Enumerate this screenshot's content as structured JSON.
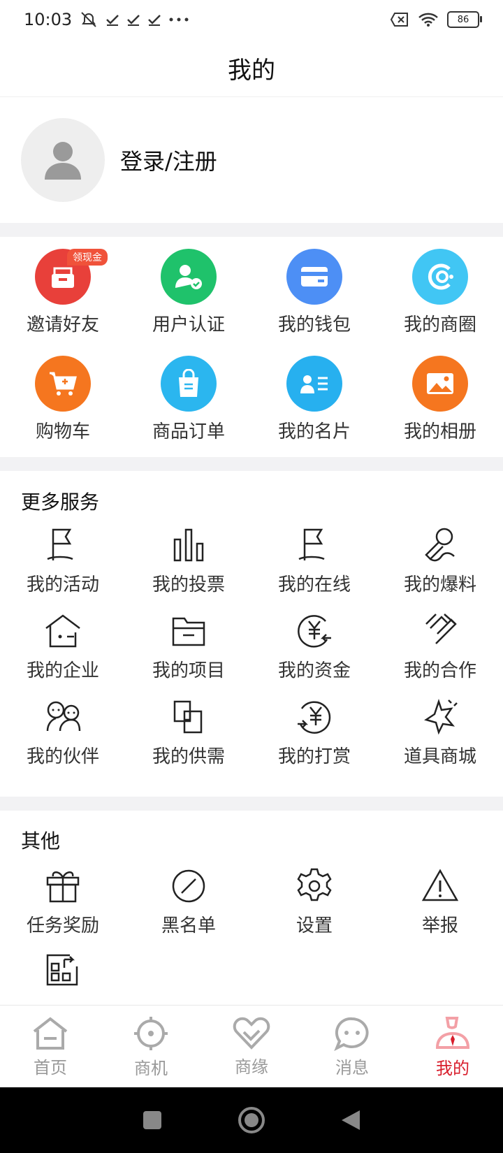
{
  "status": {
    "time": "10:03",
    "battery": "86"
  },
  "header": {
    "title": "我的"
  },
  "profile": {
    "login_label": "登录/注册"
  },
  "quick_actions": [
    {
      "label": "邀请好友",
      "icon": "invite-icon",
      "color": "#e8403a",
      "badge": "领现金"
    },
    {
      "label": "用户认证",
      "icon": "user-verify-icon",
      "color": "#1fc26b"
    },
    {
      "label": "我的钱包",
      "icon": "wallet-icon",
      "color": "#4d8ff5"
    },
    {
      "label": "我的商圈",
      "icon": "business-circle-icon",
      "color": "#41c6f4"
    },
    {
      "label": "购物车",
      "icon": "cart-icon",
      "color": "#f5761f"
    },
    {
      "label": "商品订单",
      "icon": "order-bag-icon",
      "color": "#2bb6ef"
    },
    {
      "label": "我的名片",
      "icon": "business-card-icon",
      "color": "#27b0ef"
    },
    {
      "label": "我的相册",
      "icon": "album-icon",
      "color": "#f5761f"
    }
  ],
  "more_services": {
    "title": "更多服务",
    "items": [
      {
        "label": "我的活动",
        "icon": "flag-icon"
      },
      {
        "label": "我的投票",
        "icon": "bar-chart-icon"
      },
      {
        "label": "我的在线",
        "icon": "flag-icon"
      },
      {
        "label": "我的爆料",
        "icon": "microphone-icon"
      },
      {
        "label": "我的企业",
        "icon": "company-house-icon"
      },
      {
        "label": "我的项目",
        "icon": "folder-icon"
      },
      {
        "label": "我的资金",
        "icon": "yuan-exchange-icon"
      },
      {
        "label": "我的合作",
        "icon": "handshake-icon"
      },
      {
        "label": "我的伙伴",
        "icon": "partners-icon"
      },
      {
        "label": "我的供需",
        "icon": "supply-demand-icon"
      },
      {
        "label": "我的打赏",
        "icon": "yuan-reward-icon"
      },
      {
        "label": "道具商城",
        "icon": "sparkle-icon"
      }
    ]
  },
  "others": {
    "title": "其他",
    "items": [
      {
        "label": "任务奖励",
        "icon": "gift-icon"
      },
      {
        "label": "黑名单",
        "icon": "block-icon"
      },
      {
        "label": "设置",
        "icon": "gear-icon"
      },
      {
        "label": "举报",
        "icon": "warning-icon"
      },
      {
        "label": "",
        "icon": "grid-share-icon"
      }
    ]
  },
  "bottom_nav": [
    {
      "label": "首页",
      "icon": "home-icon"
    },
    {
      "label": "商机",
      "icon": "target-icon"
    },
    {
      "label": "商缘",
      "icon": "heart-link-icon"
    },
    {
      "label": "消息",
      "icon": "message-icon"
    },
    {
      "label": "我的",
      "icon": "profile-icon",
      "active": true
    }
  ],
  "colors": {
    "accent": "#d81e2c",
    "gray": "#999999",
    "section_gap": "#f2f2f4"
  }
}
